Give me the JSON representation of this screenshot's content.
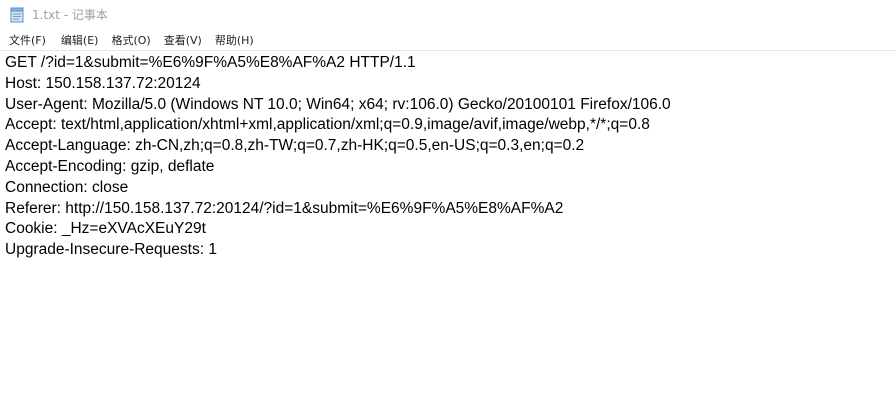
{
  "window": {
    "title": "1.txt - 记事本",
    "icon": "notepad-icon"
  },
  "menu": {
    "items": [
      {
        "label": "文件(F)"
      },
      {
        "label": "编辑(E)"
      },
      {
        "label": "格式(O)"
      },
      {
        "label": "查看(V)"
      },
      {
        "label": "帮助(H)"
      }
    ]
  },
  "editor": {
    "lines": [
      "GET /?id=1&submit=%E6%9F%A5%E8%AF%A2 HTTP/1.1",
      "Host: 150.158.137.72:20124",
      "User-Agent: Mozilla/5.0 (Windows NT 10.0; Win64; x64; rv:106.0) Gecko/20100101 Firefox/106.0",
      "Accept: text/html,application/xhtml+xml,application/xml;q=0.9,image/avif,image/webp,*/*;q=0.8",
      "Accept-Language: zh-CN,zh;q=0.8,zh-TW;q=0.7,zh-HK;q=0.5,en-US;q=0.3,en;q=0.2",
      "Accept-Encoding: gzip, deflate",
      "Connection: close",
      "Referer: http://150.158.137.72:20124/?id=1&submit=%E6%9F%A5%E8%AF%A2",
      "Cookie: _Hz=eXVAcXEuY29t",
      "Upgrade-Insecure-Requests: 1"
    ]
  }
}
